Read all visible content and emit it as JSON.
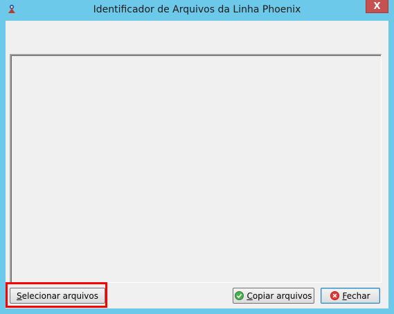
{
  "window": {
    "title": "Identificador de Arquivos da Linha Phoenix",
    "close_glyph": "X",
    "icon": "phoenix-app-icon",
    "border_color": "#6cc9ea",
    "close_color": "#c75050"
  },
  "buttons": {
    "select_first": "S",
    "select_rest": "elecionar arquivos",
    "copy_first": "C",
    "copy_rest": "opiar arquivos",
    "copy_icon": "check-circle-icon",
    "close_first": "F",
    "close_rest": "echar",
    "close_icon": "cancel-circle-icon"
  },
  "annotations": {
    "highlight_color": "#ff0000"
  }
}
